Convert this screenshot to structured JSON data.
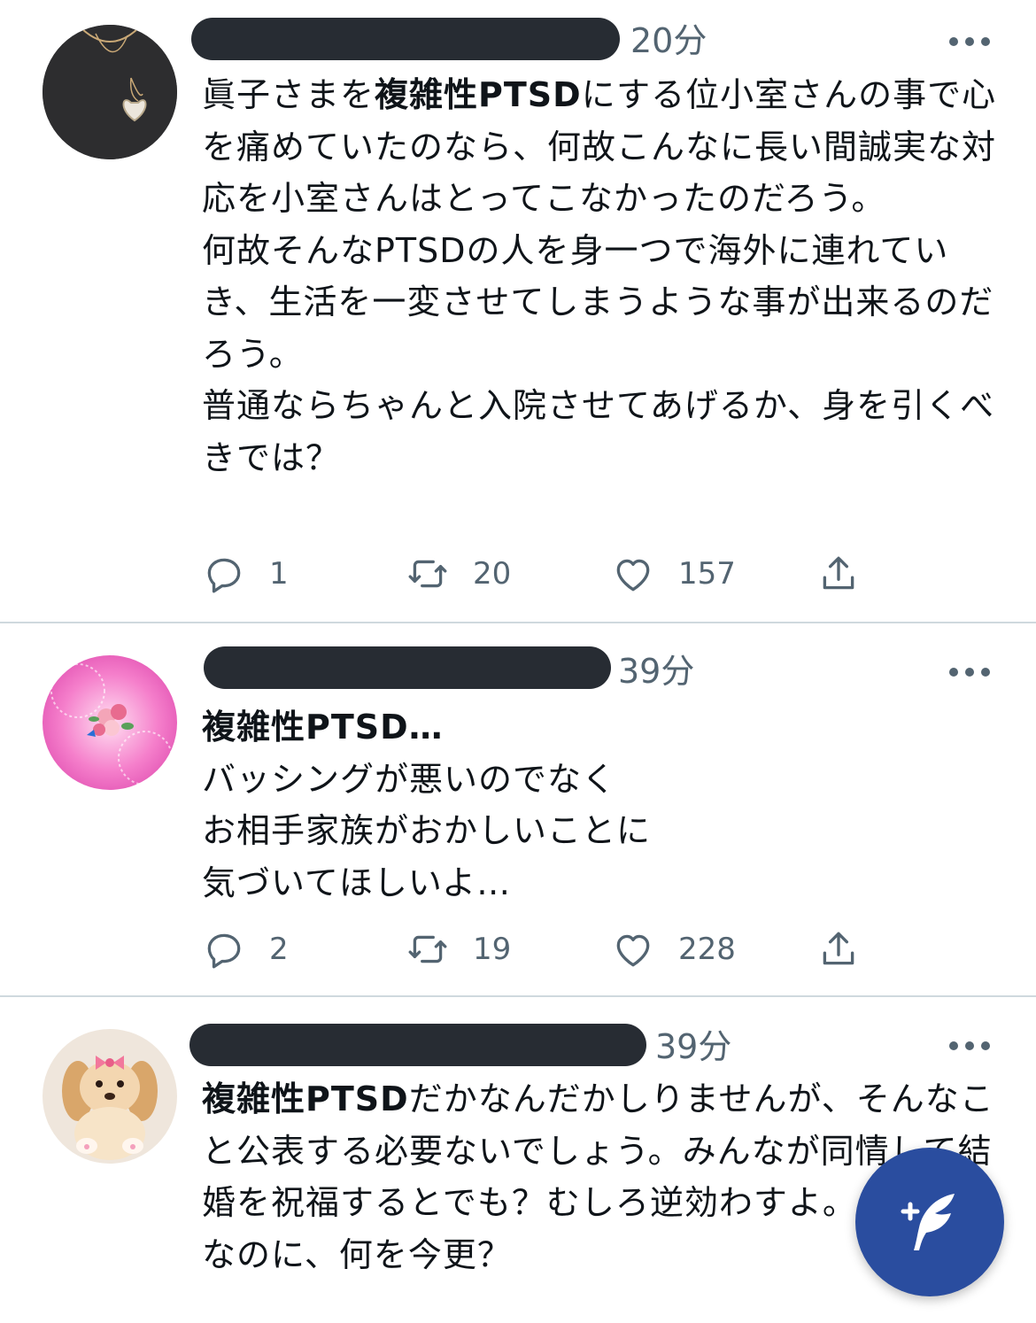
{
  "tweets": [
    {
      "time": "20分",
      "text_parts": [
        {
          "t": "眞子さまを",
          "b": false
        },
        {
          "t": "複雑性PTSD",
          "b": true
        },
        {
          "t": "にする位小室さんの事で心を痛めていたのなら、何故こんなに長い間誠実な対応を小室さんはとってこなかったのだろう。\n何故そんなPTSDの人を身一つで海外に連れていき、生活を一変させてしまうような事が出来るのだろう。\n普通ならちゃんと入院させてあげるか、身を引くべきでは？",
          "b": false
        }
      ],
      "replies": "1",
      "retweets": "20",
      "likes": "157"
    },
    {
      "time": "39分",
      "text_parts": [
        {
          "t": "複雑性PTSD…",
          "b": true
        },
        {
          "t": "\nバッシングが悪いのでなく\nお相手家族がおかしいことに\n気づいてほしいよ…",
          "b": false
        }
      ],
      "replies": "2",
      "retweets": "19",
      "likes": "228"
    },
    {
      "time": "39分",
      "text_parts": [
        {
          "t": "複雑性PTSD",
          "b": true
        },
        {
          "t": "だかなんだかしりませんが、そんなこと公表する必要ないでしょう。みんなが同情して結婚を祝福するとでも？むしろ逆効わすよ。自業自得なのに、何を今更？",
          "b": false
        }
      ]
    }
  ],
  "colors": {
    "text": "#0f1419",
    "secondary": "#536471",
    "divider": "#cfd9de",
    "fab": "#2a4d9f",
    "redaction": "#272c33"
  },
  "icons": {
    "reply": "reply-icon",
    "retweet": "retweet-icon",
    "like": "heart-icon",
    "share": "share-icon",
    "more": "more-icon",
    "compose": "compose-tweet-icon"
  }
}
